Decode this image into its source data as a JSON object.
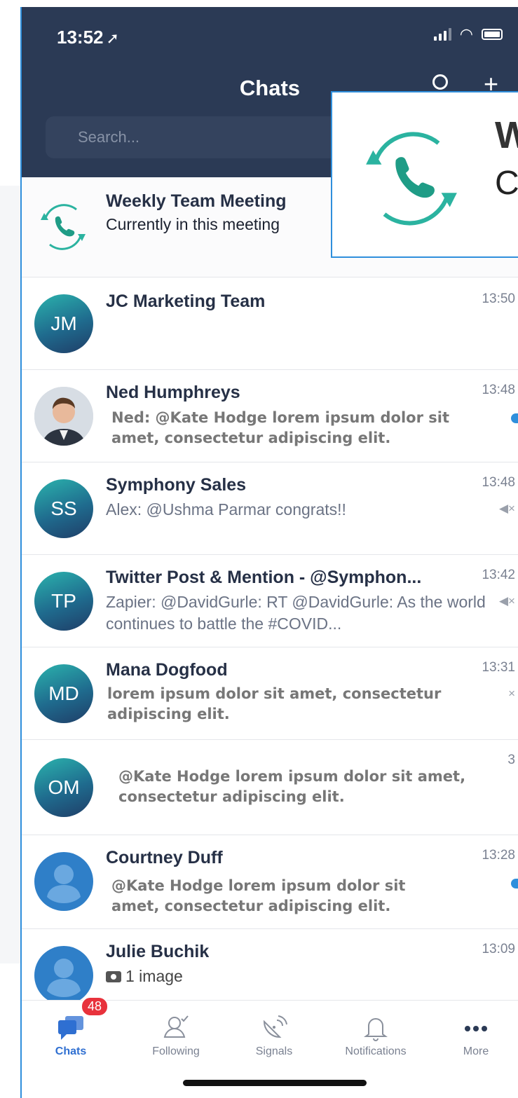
{
  "status_bar": {
    "time": "13:52",
    "location_glyph": "➚"
  },
  "header": {
    "title": "Chats",
    "search_placeholder": "Search..."
  },
  "zoom_callout": {
    "line1": "W",
    "line2": "C"
  },
  "chats": [
    {
      "type": "meeting",
      "name": "Weekly Team Meeting",
      "subtitle": "Currently in this meeting"
    },
    {
      "initials": "JM",
      "name": "JC Marketing Team",
      "time": "13:50",
      "preview": ""
    },
    {
      "photo": true,
      "name": "Ned Humphreys",
      "time": "13:48",
      "preview": "Ned: @Kate Hodge lorem ipsum dolor sit amet, consectetur adipiscing elit.",
      "unread": true
    },
    {
      "initials": "SS",
      "name": "Symphony Sales",
      "time": "13:48",
      "preview": "Alex: @Ushma Parmar congrats!!",
      "muted": true
    },
    {
      "initials": "TP",
      "name": "Twitter Post & Mention - @Symphon...",
      "time": "13:42",
      "preview": "Zapier: @DavidGurle: RT @DavidGurle: As the world continues to battle the #COVID...",
      "muted": true
    },
    {
      "initials": "MD",
      "name": "Mana Dogfood",
      "time": "13:31",
      "preview": "lorem ipsum dolor sit amet, consectetur adipiscing elit."
    },
    {
      "initials": "OM",
      "name": "",
      "time": "3",
      "preview": "@Kate Hodge lorem ipsum dolor sit amet, consectetur adipiscing elit."
    },
    {
      "default_avatar": true,
      "name": "Courtney Duff",
      "time": "13:28",
      "preview": "@Kate Hodge lorem ipsum dolor sit amet, consectetur adipiscing elit.",
      "unread": true
    },
    {
      "default_avatar": true,
      "name": "Julie Buchik",
      "time": "13:09",
      "preview": "1 image",
      "attachment_icon": "camera-icon"
    }
  ],
  "tabs": [
    {
      "label": "Chats",
      "icon": "chat-bubbles-icon",
      "badge": "48",
      "active": true
    },
    {
      "label": "Following",
      "icon": "user-check-icon"
    },
    {
      "label": "Signals",
      "icon": "satellite-dish-icon"
    },
    {
      "label": "Notifications",
      "icon": "bell-icon"
    },
    {
      "label": "More",
      "icon": "more-dots-icon"
    }
  ],
  "colors": {
    "header_bg": "#2b3a55",
    "accent": "#2f6fd1",
    "badge": "#e8323c",
    "callout_border": "#2f8fdc"
  }
}
